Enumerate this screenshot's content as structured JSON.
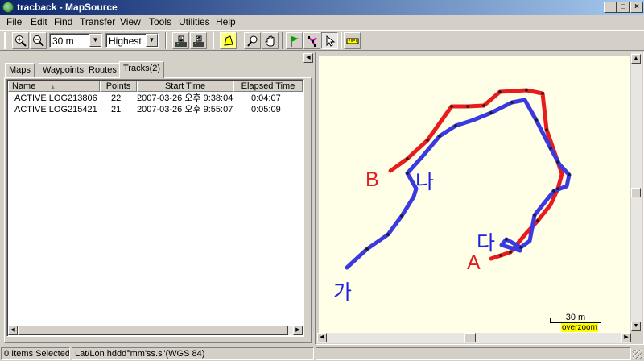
{
  "window": {
    "title": "tracback - MapSource",
    "controls": [
      "_",
      "□",
      "×"
    ]
  },
  "menu": [
    "File",
    "Edit",
    "Find",
    "Transfer",
    "View",
    "Tools",
    "Utilities",
    "Help"
  ],
  "toolbar": {
    "zoom_level": "30 m",
    "detail_level": "Highest",
    "icons": [
      "zoom-in-icon",
      "zoom-out-icon",
      "receive-from-device-icon",
      "send-to-device-icon",
      "map-tool-icon",
      "zoom-tool-icon",
      "pan-hand-icon",
      "waypoint-flag-icon",
      "route-tool-icon",
      "selection-arrow-icon",
      "measure-ruler-icon"
    ]
  },
  "tabs": [
    "Maps",
    "Waypoints",
    "Routes",
    "Tracks(2)"
  ],
  "active_tab": "Tracks(2)",
  "table": {
    "columns": [
      "Name",
      "Points",
      "Start Time",
      "Elapsed Time"
    ],
    "rows": [
      [
        "ACTIVE LOG213806",
        "22",
        "2007-03-26 오후 9:38:04",
        "0:04:07"
      ],
      [
        "ACTIVE LOG215421",
        "21",
        "2007-03-26 오후 9:55:07",
        "0:05:09"
      ]
    ]
  },
  "map": {
    "labels": {
      "A": "A",
      "B": "B",
      "ga": "가",
      "na": "나",
      "da": "다"
    },
    "scale_label": "30 m",
    "overzoom_label": "overzoom",
    "track_colors": {
      "red": "#e81c1c",
      "blue": "#3a3ae0"
    },
    "label_colors": {
      "red": "#e02020",
      "blue": "#2020e0"
    }
  },
  "status": {
    "selected": "0 Items Selected",
    "coords": "Lat/Lon hddd°mm'ss.s\"(WGS 84)"
  }
}
